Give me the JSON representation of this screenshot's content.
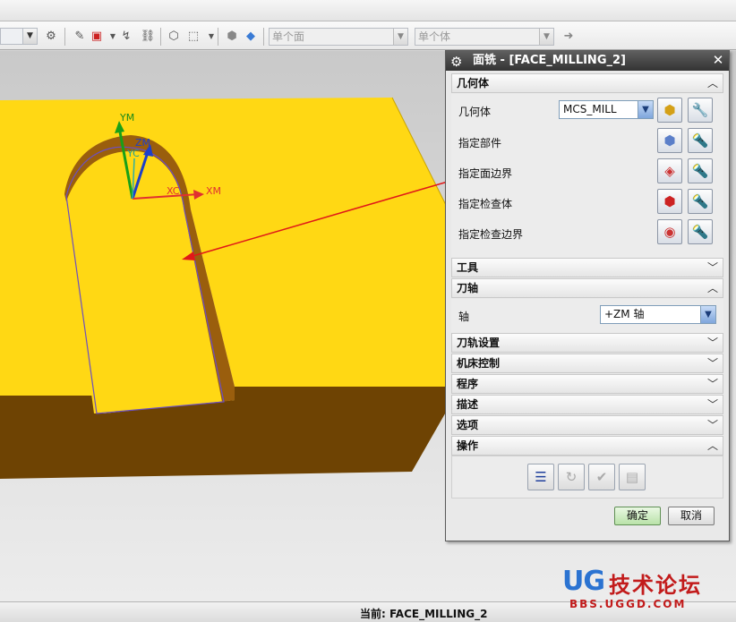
{
  "toolbar": {
    "filter_select_1": "单个面",
    "filter_select_2": "单个体"
  },
  "viewport": {
    "axis_labels": {
      "ym": "YM",
      "zm": "ZM",
      "yc": "YC",
      "xc": "XC",
      "xm": "XM"
    },
    "colors": {
      "part_top": "#ffd814",
      "part_side": "#6e4303",
      "pocket_wall": "#9a5e0d",
      "arrow": "#e01818"
    }
  },
  "dialog": {
    "title": "面铣 - [FACE_MILLING_2]",
    "sections": {
      "geometry": "几何体",
      "tool": "工具",
      "tool_axis": "刀轴",
      "path_settings": "刀轨设置",
      "machine_control": "机床控制",
      "program": "程序",
      "description": "描述",
      "options": "选项",
      "actions": "操作"
    },
    "geometry_rows": {
      "geometry_label": "几何体",
      "geometry_value": "MCS_MILL",
      "specify_part": "指定部件",
      "specify_face_boundary": "指定面边界",
      "specify_check_body": "指定检查体",
      "specify_check_boundary": "指定检查边界"
    },
    "axis_row": {
      "label": "轴",
      "value": "+ZM 轴"
    },
    "buttons": {
      "ok": "确定",
      "cancel": "取消"
    }
  },
  "statusbar": {
    "current": "当前: FACE_MILLING_2"
  },
  "watermark": {
    "logo": "UG",
    "cn": "技术论坛",
    "url": "BBS.UGGD.COM"
  }
}
